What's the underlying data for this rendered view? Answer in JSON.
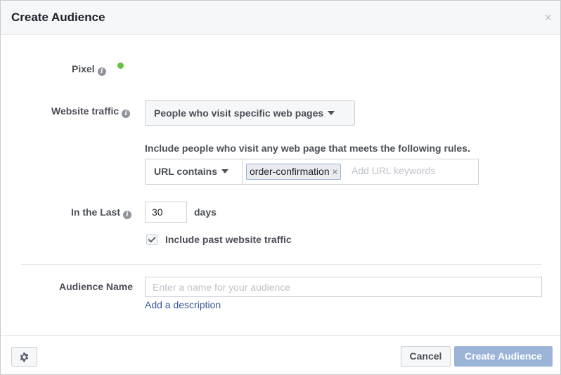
{
  "dialog": {
    "title": "Create Audience",
    "close_glyph": "×"
  },
  "pixel": {
    "label": "Pixel",
    "info_glyph": "i",
    "status_color": "#6bbe45"
  },
  "website_traffic": {
    "label": "Website traffic",
    "info_glyph": "i",
    "selected": "People who visit specific web pages"
  },
  "rules": {
    "description": "Include people who visit any web page that meets the following rules.",
    "operator": "URL contains",
    "tokens": [
      {
        "text": "order-confirmation",
        "remove_glyph": "×"
      }
    ],
    "keyword_placeholder": "Add URL keywords"
  },
  "retention": {
    "label": "In the Last",
    "info_glyph": "i",
    "value": "30",
    "unit": "days"
  },
  "past_traffic": {
    "label": "Include past website traffic",
    "checked": true
  },
  "audience_name": {
    "label": "Audience Name",
    "placeholder": "Enter a name for your audience",
    "add_description_link": "Add a description"
  },
  "footer": {
    "settings_icon": "gear-icon",
    "cancel_label": "Cancel",
    "create_label": "Create Audience"
  },
  "colors": {
    "link": "#365899",
    "primary_disabled": "#9cb4d8"
  }
}
